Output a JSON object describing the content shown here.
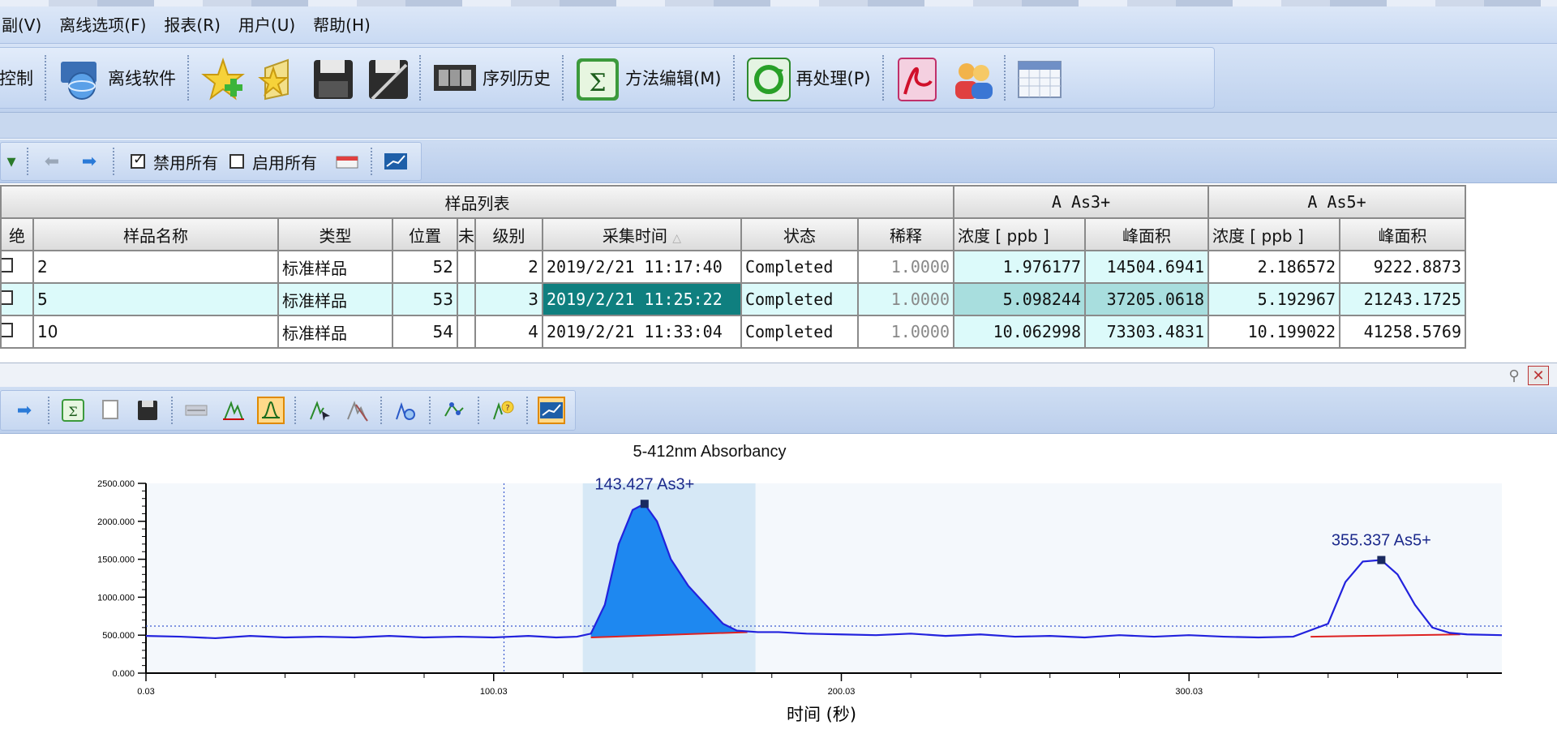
{
  "menu": [
    "副(V)",
    "离线选项(F)",
    "报表(R)",
    "用户(U)",
    "帮助(H)"
  ],
  "toolbar1": {
    "control_label": "控制",
    "offline_label": "离线软件",
    "seq_history_label": "序列历史",
    "method_edit_label": "方法编辑(M)",
    "reprocess_label": "再处理(P)"
  },
  "toolbar2": {
    "disable_all_label": "禁用所有",
    "enable_all_label": "启用所有"
  },
  "table": {
    "group_headers": {
      "sample_list": "样品列表",
      "as3": "A  As3+",
      "as5": "A  As5+"
    },
    "columns": {
      "abs": "绝",
      "name": "样品名称",
      "type": "类型",
      "pos": "位置",
      "narrow": "未",
      "level": "级别",
      "acq_time": "采集时间",
      "status": "状态",
      "dilution": "稀释",
      "conc1": "浓度 [ ppb ]",
      "area1": "峰面积",
      "conc2": "浓度 [ ppb ]",
      "area2": "峰面积"
    },
    "rows": [
      {
        "name": "2",
        "type": "标准样品",
        "pos": "52",
        "level": "2",
        "time": "2019/2/21 11:17:40",
        "status": "Completed",
        "dilution": "1.0000",
        "conc1": "1.976177",
        "area1": "14504.6941",
        "conc2": "2.186572",
        "area2": "9222.8873"
      },
      {
        "name": "5",
        "type": "标准样品",
        "pos": "53",
        "level": "3",
        "time": "2019/2/21 11:25:22",
        "status": "Completed",
        "dilution": "1.0000",
        "conc1": "5.098244",
        "area1": "37205.0618",
        "conc2": "5.192967",
        "area2": "21243.1725"
      },
      {
        "name": "10",
        "type": "标准样品",
        "pos": "54",
        "level": "4",
        "time": "2019/2/21 11:33:04",
        "status": "Completed",
        "dilution": "1.0000",
        "conc1": "10.062998",
        "area1": "73303.4831",
        "conc2": "10.199022",
        "area2": "41258.5769"
      }
    ]
  },
  "chart_data": {
    "type": "line",
    "title": "5-412nm Absorbancy",
    "xlabel": "时间 (秒)",
    "ylabel": "",
    "xlim": [
      0.03,
      390
    ],
    "ylim": [
      0,
      2500
    ],
    "x_ticks": [
      "0.03",
      "100.03",
      "200.03",
      "300.03"
    ],
    "y_ticks": [
      "0.000",
      "500.000",
      "1000.000",
      "1500.000",
      "2000.000",
      "2500.000"
    ],
    "series": [
      {
        "color": "#2222dd",
        "x": [
          0.03,
          10,
          20,
          30,
          40,
          50,
          60,
          70,
          80,
          90,
          100,
          110,
          118,
          124,
          128,
          132,
          136,
          140,
          143.4,
          147,
          151,
          156,
          161,
          166,
          170,
          176,
          182,
          190,
          200,
          210,
          220,
          230,
          240,
          250,
          260,
          270,
          280,
          290,
          300,
          310,
          320,
          330,
          340,
          345,
          350,
          355.3,
          360,
          365,
          370,
          375,
          380,
          390
        ],
        "y": [
          490,
          480,
          460,
          490,
          470,
          480,
          470,
          490,
          470,
          480,
          470,
          490,
          470,
          480,
          520,
          900,
          1700,
          2150,
          2230,
          2000,
          1500,
          1150,
          900,
          650,
          560,
          540,
          540,
          520,
          510,
          500,
          520,
          490,
          510,
          480,
          490,
          470,
          500,
          480,
          500,
          480,
          470,
          480,
          650,
          1200,
          1470,
          1490,
          1300,
          900,
          600,
          530,
          510,
          500
        ]
      }
    ],
    "baseline_color": "#dd2222",
    "threshold": 620,
    "marker_x": 103,
    "peaks": [
      {
        "label": "143.427 As3+",
        "x": 143.427,
        "y": 2230,
        "start": 128,
        "end": 173,
        "fill": "#1e88f0"
      },
      {
        "label": "355.337 As5+",
        "x": 355.337,
        "y": 1490,
        "start": 335,
        "end": 378
      }
    ],
    "grid": false,
    "legend": "none"
  }
}
